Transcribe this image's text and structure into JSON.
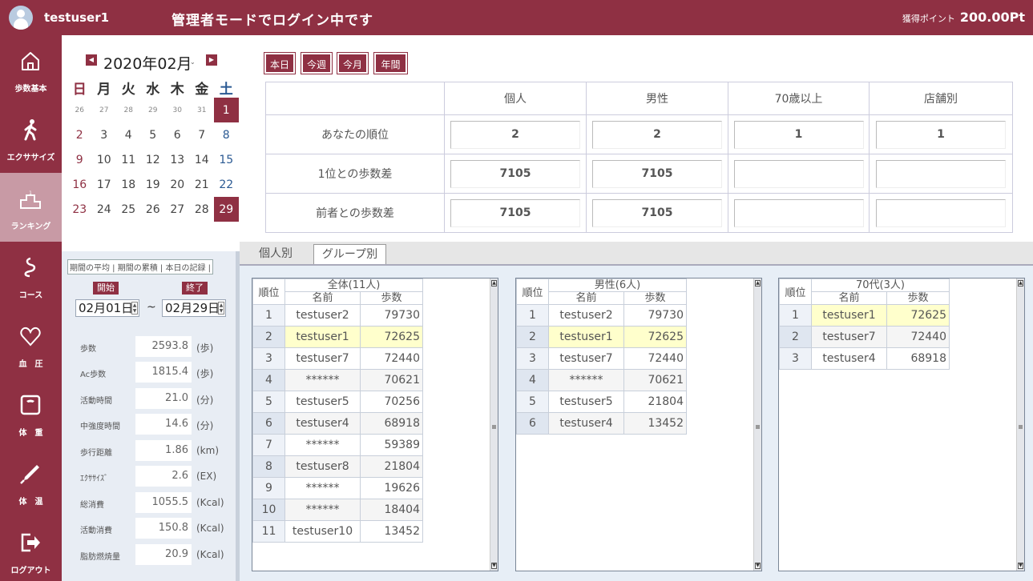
{
  "header": {
    "username": "testuser1",
    "mode_text": "管理者モードでログイン中です",
    "points_label": "獲得ポイント",
    "points_value": "200.00Pt"
  },
  "nav": [
    {
      "label": "歩数基本",
      "icon": "home-icon"
    },
    {
      "label": "エクササイズ",
      "icon": "walking-icon"
    },
    {
      "label": "ランキング",
      "icon": "podium-icon"
    },
    {
      "label": "コース",
      "icon": "course-icon"
    },
    {
      "label": "血　圧",
      "icon": "heart-icon"
    },
    {
      "label": "体　重",
      "icon": "scale-icon"
    },
    {
      "label": "体　温",
      "icon": "thermometer-icon"
    },
    {
      "label": "ログアウト",
      "icon": "logout-icon"
    }
  ],
  "calendar": {
    "title": "2020年02月",
    "weekdays": [
      "日",
      "月",
      "火",
      "水",
      "木",
      "金",
      "土"
    ],
    "weeks": [
      [
        "26",
        "27",
        "28",
        "29",
        "30",
        "31",
        "1"
      ],
      [
        "2",
        "3",
        "4",
        "5",
        "6",
        "7",
        "8"
      ],
      [
        "9",
        "10",
        "11",
        "12",
        "13",
        "14",
        "15"
      ],
      [
        "16",
        "17",
        "18",
        "19",
        "20",
        "21",
        "22"
      ],
      [
        "23",
        "24",
        "25",
        "26",
        "27",
        "28",
        "29"
      ]
    ]
  },
  "stats": {
    "tabs": "期間の平均 | 期間の累積 | 本日の記録 |",
    "start_label": "開始",
    "end_label": "終了",
    "start_date": "02月01日",
    "end_date": "02月29日",
    "tilde": "~",
    "rows": [
      {
        "label": "歩数",
        "value": "2593.8",
        "unit": "(歩)"
      },
      {
        "label": "Ac歩数",
        "value": "1815.4",
        "unit": "(歩)"
      },
      {
        "label": "活動時間",
        "value": "21.0",
        "unit": "(分)"
      },
      {
        "label": "中強度時間",
        "value": "14.6",
        "unit": "(分)"
      },
      {
        "label": "歩行距離",
        "value": "1.86",
        "unit": "(km)"
      },
      {
        "label": "ｴｸｻｻｲｽﾞ",
        "value": "2.6",
        "unit": "(EX)"
      },
      {
        "label": "総消費",
        "value": "1055.5",
        "unit": "(Kcal)"
      },
      {
        "label": "活動消費",
        "value": "150.8",
        "unit": "(Kcal)"
      },
      {
        "label": "脂肪燃焼量",
        "value": "20.9",
        "unit": "(Kcal)"
      }
    ]
  },
  "periods": [
    "本日",
    "今週",
    "今月",
    "年間"
  ],
  "rank_table": {
    "columns": [
      "個人",
      "男性",
      "70歳以上",
      "店舗別"
    ],
    "rows": [
      {
        "label": "あなたの順位",
        "values": [
          "2",
          "2",
          "1",
          "1"
        ]
      },
      {
        "label": "1位との歩数差",
        "values": [
          "7105",
          "7105",
          "",
          ""
        ]
      },
      {
        "label": "前者との歩数差",
        "values": [
          "7105",
          "7105",
          "",
          ""
        ]
      }
    ]
  },
  "tabs": [
    "個人別",
    "グループ別"
  ],
  "lists": [
    {
      "title": "全体(11人)",
      "rank_header": "順位",
      "name_header": "名前",
      "steps_header": "歩数",
      "rows": [
        [
          "1",
          "testuser2",
          "79730"
        ],
        [
          "2",
          "testuser1",
          "72625"
        ],
        [
          "3",
          "testuser7",
          "72440"
        ],
        [
          "4",
          "******",
          "70621"
        ],
        [
          "5",
          "testuser5",
          "70256"
        ],
        [
          "6",
          "testuser4",
          "68918"
        ],
        [
          "7",
          "******",
          "59389"
        ],
        [
          "8",
          "testuser8",
          "21804"
        ],
        [
          "9",
          "******",
          "19626"
        ],
        [
          "10",
          "******",
          "18404"
        ],
        [
          "11",
          "testuser10",
          "13452"
        ]
      ]
    },
    {
      "title": "男性(6人)",
      "rank_header": "順位",
      "name_header": "名前",
      "steps_header": "歩数",
      "rows": [
        [
          "1",
          "testuser2",
          "79730"
        ],
        [
          "2",
          "testuser1",
          "72625"
        ],
        [
          "3",
          "testuser7",
          "72440"
        ],
        [
          "4",
          "******",
          "70621"
        ],
        [
          "5",
          "testuser5",
          "21804"
        ],
        [
          "6",
          "testuser4",
          "13452"
        ]
      ]
    },
    {
      "title": "70代(3人)",
      "rank_header": "順位",
      "name_header": "名前",
      "steps_header": "歩数",
      "rows": [
        [
          "1",
          "testuser1",
          "72625"
        ],
        [
          "2",
          "testuser7",
          "72440"
        ],
        [
          "3",
          "testuser4",
          "68918"
        ]
      ]
    }
  ]
}
